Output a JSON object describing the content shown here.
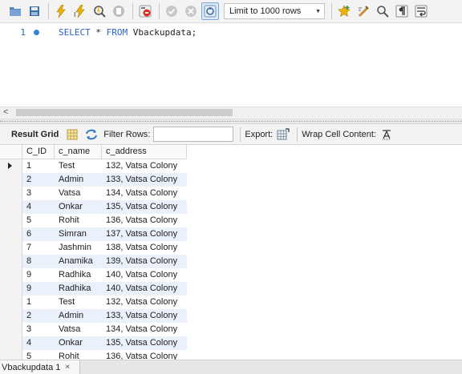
{
  "toolbar": {
    "limit_label": "Limit to 1000 rows",
    "accent_color": "#2f86d6"
  },
  "editor": {
    "line_number": "1",
    "keywords": [
      "SELECT",
      "FROM"
    ],
    "star": " * ",
    "table": " Vbackupdata;"
  },
  "result_toolbar": {
    "result_grid": "Result Grid",
    "filter_rows": "Filter Rows:",
    "filter_value": "",
    "export": "Export:",
    "wrap_cell": "Wrap Cell Content:"
  },
  "grid": {
    "columns": [
      "C_ID",
      "c_name",
      "c_address"
    ],
    "rows": [
      [
        "1",
        "Test",
        "132, Vatsa Colony"
      ],
      [
        "2",
        "Admin",
        "133, Vatsa Colony"
      ],
      [
        "3",
        "Vatsa",
        "134, Vatsa Colony"
      ],
      [
        "4",
        "Onkar",
        "135, Vatsa Colony"
      ],
      [
        "5",
        "Rohit",
        "136, Vatsa Colony"
      ],
      [
        "6",
        "Simran",
        "137, Vatsa Colony"
      ],
      [
        "7",
        "Jashmin",
        "138, Vatsa Colony"
      ],
      [
        "8",
        "Anamika",
        "139, Vatsa Colony"
      ],
      [
        "9",
        "Radhika",
        "140, Vatsa Colony"
      ],
      [
        "9",
        "Radhika",
        "140, Vatsa Colony"
      ],
      [
        "1",
        "Test",
        "132, Vatsa Colony"
      ],
      [
        "2",
        "Admin",
        "133, Vatsa Colony"
      ],
      [
        "3",
        "Vatsa",
        "134, Vatsa Colony"
      ],
      [
        "4",
        "Onkar",
        "135, Vatsa Colony"
      ],
      [
        "5",
        "Rohit",
        "136, Vatsa Colony"
      ]
    ]
  },
  "tab": {
    "label": "Vbackupdata 1",
    "close": "×"
  }
}
